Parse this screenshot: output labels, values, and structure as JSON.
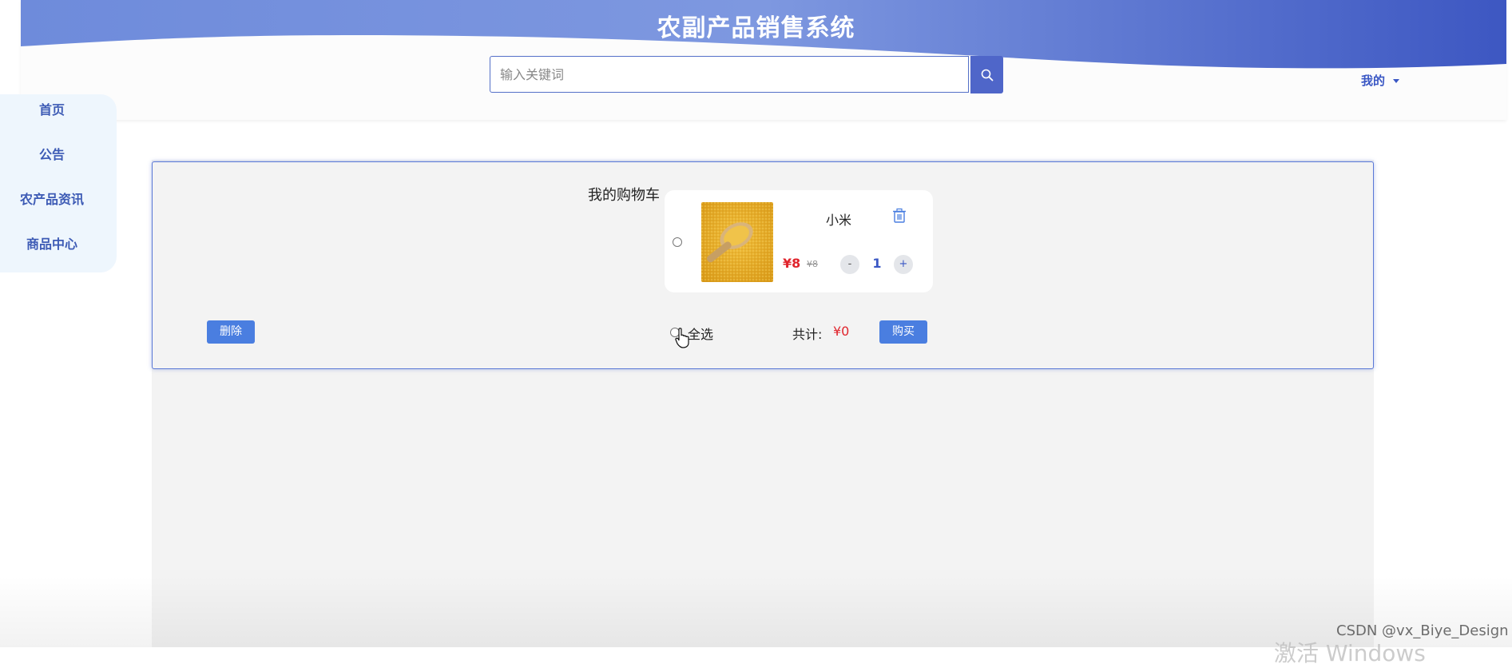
{
  "header": {
    "title": "农副产品销售系统",
    "search_placeholder": "输入关键词",
    "search_icon": "search-icon",
    "user_menu_label": "我的",
    "wave_colors": [
      "#4a63c6",
      "#7e98e0"
    ]
  },
  "sidebar": {
    "items": [
      {
        "label": "首页"
      },
      {
        "label": "公告"
      },
      {
        "label": "农产品资讯"
      },
      {
        "label": "商品中心"
      }
    ]
  },
  "cart": {
    "title": "我的购物车",
    "items": [
      {
        "name": "小米",
        "price": "¥8",
        "original_price": "¥8",
        "quantity": "1",
        "minus_label": "-",
        "plus_label": "+",
        "delete_icon": "trash-icon",
        "image": "millet-product-image"
      }
    ],
    "delete_label": "删除",
    "select_all_label": "全选",
    "total_label": "共计:",
    "total_value": "¥0",
    "buy_label": "购买"
  },
  "watermark": {
    "text": "CSDN @vx_Biye_Design",
    "activate_windows": "激活 Windows"
  },
  "colors": {
    "accent": "#4f66c9",
    "button": "#4a7ee0",
    "price": "#e0242c",
    "nav_text": "#3d5bb5"
  }
}
